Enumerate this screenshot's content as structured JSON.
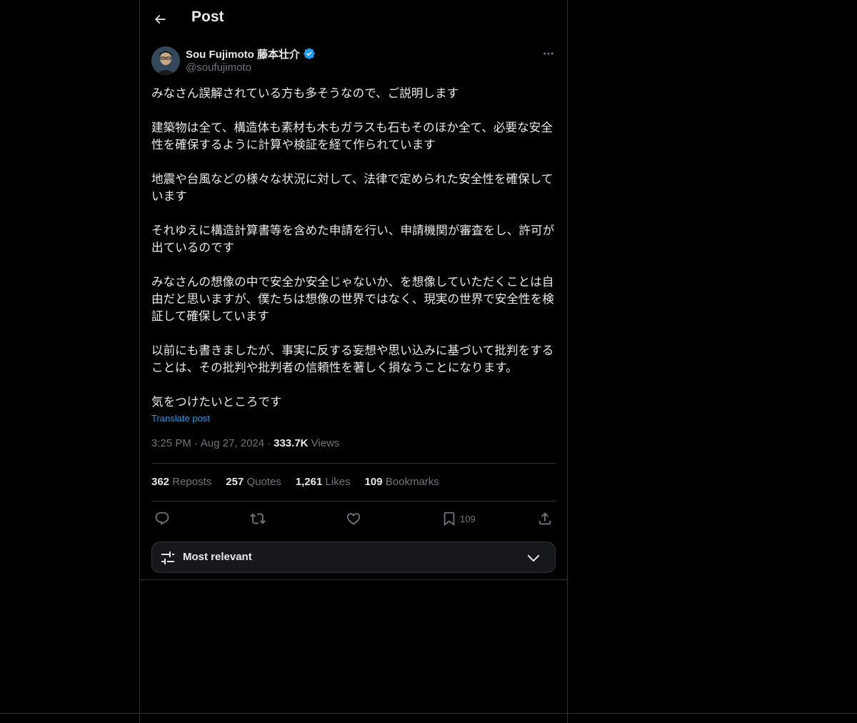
{
  "header": {
    "title": "Post"
  },
  "author": {
    "name": "Sou Fujimoto 藤本壮介",
    "handle": "@soufujimoto",
    "verified": true
  },
  "post": {
    "paragraphs": [
      "みなさん誤解されている方も多そうなので、ご説明します",
      "建築物は全て、構造体も素材も木もガラスも石もそのほか全て、必要な安全性を確保するように計算や検証を経て作られています",
      "地震や台風などの様々な状況に対して、法律で定められた安全性を確保しています",
      "それゆえに構造計算書等を含めた申請を行い、申請機関が審査をし、許可が出ているのです",
      "みなさんの想像の中で安全か安全じゃないか、を想像していただくことは自由だと思いますが、僕たちは想像の世界ではなく、現実の世界で安全性を検証して確保しています",
      "以前にも書きましたが、事実に反する妄想や思い込みに基づいて批判をすることは、その批判や批判者の信頼性を著しく損なうことになります。",
      "気をつけたいところです"
    ],
    "translate_label": "Translate post",
    "time": "3:25 PM",
    "date": "Aug 27, 2024",
    "views_count": "333.7K",
    "views_label": "Views"
  },
  "stats": {
    "reposts": {
      "count": "362",
      "label": "Reposts"
    },
    "quotes": {
      "count": "257",
      "label": "Quotes"
    },
    "likes": {
      "count": "1,261",
      "label": "Likes"
    },
    "bookmarks": {
      "count": "109",
      "label": "Bookmarks"
    }
  },
  "actions": {
    "bookmark_count": "109"
  },
  "sort": {
    "label": "Most relevant"
  },
  "colors": {
    "background": "#000000",
    "text": "#e7e9ea",
    "muted": "#71767b",
    "accent": "#1d9bf0",
    "border": "#2f3336"
  },
  "icons": [
    "back-arrow-icon",
    "verified-badge-icon",
    "more-options-icon",
    "reply-icon",
    "repost-icon",
    "like-icon",
    "bookmark-icon",
    "share-icon",
    "sort-sliders-icon",
    "chevron-down-icon"
  ]
}
